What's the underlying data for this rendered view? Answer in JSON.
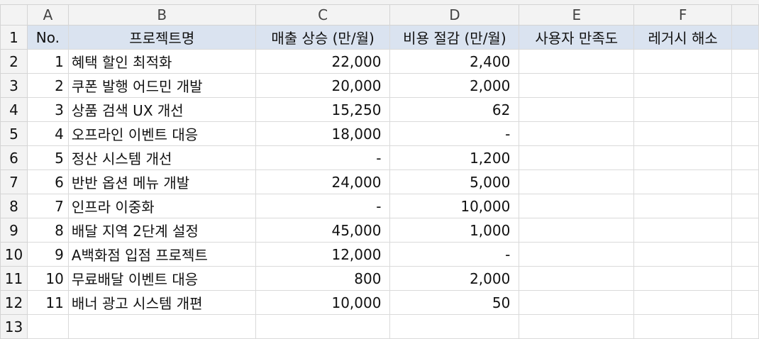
{
  "columns": [
    "A",
    "B",
    "C",
    "D",
    "E",
    "F"
  ],
  "header": {
    "row": "1",
    "no": "No.",
    "project": "프로젝트명",
    "sales": "매출 상승 (만/월)",
    "cost": "비용 절감 (만/월)",
    "satisfaction": "사용자 만족도",
    "legacy": "레거시 해소"
  },
  "rows": [
    {
      "row": "2",
      "no": "1",
      "name": "혜택 할인 최적화",
      "sales": "22,000",
      "cost": "2,400"
    },
    {
      "row": "3",
      "no": "2",
      "name": "쿠폰 발행 어드민 개발",
      "sales": "20,000",
      "cost": "2,000"
    },
    {
      "row": "4",
      "no": "3",
      "name": "상품 검색 UX 개선",
      "sales": "15,250",
      "cost": "62"
    },
    {
      "row": "5",
      "no": "4",
      "name": "오프라인 이벤트 대응",
      "sales": "18,000",
      "cost": "-"
    },
    {
      "row": "6",
      "no": "5",
      "name": "정산 시스템 개선",
      "sales": "-",
      "cost": "1,200"
    },
    {
      "row": "7",
      "no": "6",
      "name": "반반 옵션 메뉴 개발",
      "sales": "24,000",
      "cost": "5,000"
    },
    {
      "row": "8",
      "no": "7",
      "name": "인프라 이중화",
      "sales": "-",
      "cost": "10,000"
    },
    {
      "row": "9",
      "no": "8",
      "name": "배달 지역 2단계 설정",
      "sales": "45,000",
      "cost": "1,000"
    },
    {
      "row": "10",
      "no": "9",
      "name": "A백화점 입점 프로젝트",
      "sales": "12,000",
      "cost": "-"
    },
    {
      "row": "11",
      "no": "10",
      "name": "무료배달 이벤트 대응",
      "sales": "800",
      "cost": "2,000"
    },
    {
      "row": "12",
      "no": "11",
      "name": "배너 광고 시스템 개편",
      "sales": "10,000",
      "cost": "50"
    }
  ],
  "last_row": "13"
}
